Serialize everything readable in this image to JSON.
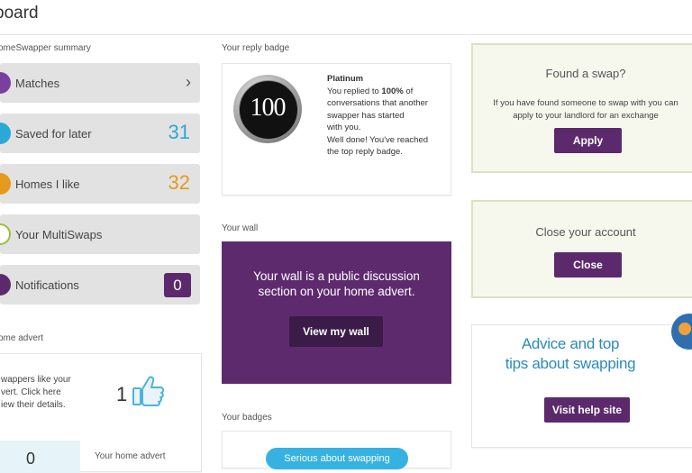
{
  "page": {
    "title": "board"
  },
  "summary": {
    "heading": "omeSwapper summary",
    "items": [
      {
        "label": "Matches",
        "value": "",
        "color": "#7b3fa0"
      },
      {
        "label": "Saved for later",
        "value": "31",
        "color": "#2aa9d6"
      },
      {
        "label": "Homes I like",
        "value": "32",
        "color": "#e39a1d"
      },
      {
        "label": "Your MultiSwaps",
        "value": "",
        "color": "#9bbf3a"
      },
      {
        "label": "Notifications",
        "value": "0",
        "color": "#5c2a6c"
      }
    ]
  },
  "home_advert": {
    "heading": "ome advert",
    "text_line1": "wappers like your",
    "text_line2": "vert. Click here",
    "text_line3": "iew their details.",
    "likes": "1",
    "bottom_label": "Your home advert",
    "bottom_num": "0"
  },
  "reply_badge": {
    "heading": "Your reply badge",
    "badge_number": "100",
    "level": "Platinum",
    "line1_pre": "You replied to ",
    "line1_pct": "100%",
    "line1_post": " of",
    "line2": "conversations that another",
    "line3": "swapper has started",
    "line4": "with you.",
    "line5": "Well done! You've reached",
    "line6": "the top reply badge."
  },
  "wall": {
    "heading": "Your wall",
    "text_line1": "Your wall is a public discussion",
    "text_line2": "section on your home advert.",
    "button": "View my wall"
  },
  "badges": {
    "heading": "Your badges",
    "pill": "Serious about swapping"
  },
  "found_swap": {
    "title": "Found a swap?",
    "text_line1": "If you have found someone to swap with you can",
    "text_line2": "apply to your landlord for an exchange",
    "button": "Apply"
  },
  "close_account": {
    "title": "Close your account",
    "button": "Close"
  },
  "advice": {
    "line1": "Advice and top",
    "line2": "tips about swapping",
    "button": "Visit help site"
  },
  "colors": {
    "accent": "#5c2a6c",
    "blue_num": "#2aa9d6",
    "orange_num": "#e39a1d"
  }
}
